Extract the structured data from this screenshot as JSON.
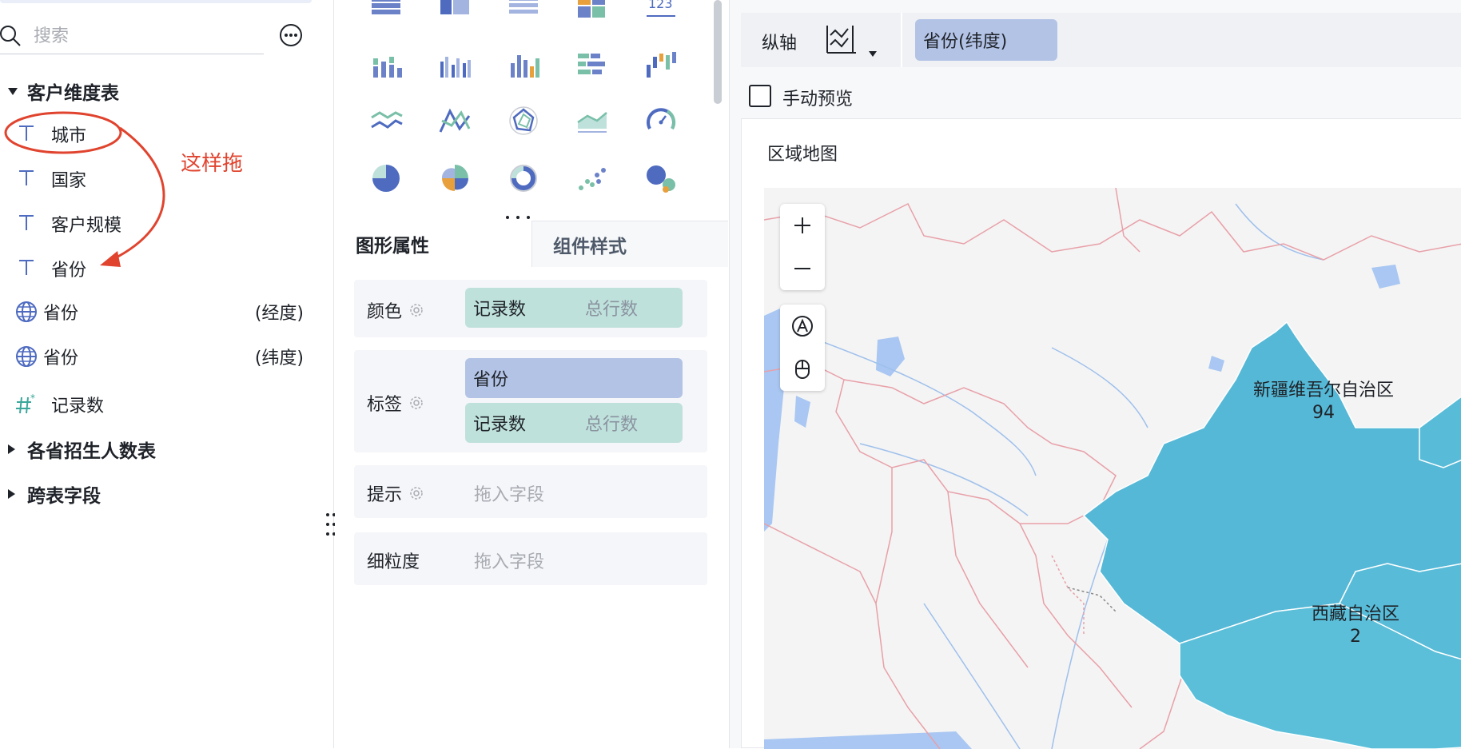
{
  "left": {
    "search_placeholder": "搜索",
    "groups": [
      {
        "label": "客户维度表",
        "expanded": true
      },
      {
        "label": "各省招生人数表",
        "expanded": false
      },
      {
        "label": "跨表字段",
        "expanded": false
      }
    ],
    "fields": [
      {
        "type": "text",
        "label": "城市"
      },
      {
        "type": "text",
        "label": "国家"
      },
      {
        "type": "text",
        "label": "客户规模"
      },
      {
        "type": "text",
        "label": "省份"
      },
      {
        "type": "geo",
        "label": "省份",
        "suffix": "(经度)"
      },
      {
        "type": "geo",
        "label": "省份",
        "suffix": "(纬度)"
      },
      {
        "type": "measure",
        "label": "记录数"
      }
    ],
    "annotation": "这样拖"
  },
  "middle": {
    "tabs": [
      "图形属性",
      "组件样式"
    ],
    "active_tab": "图形属性",
    "properties": {
      "color": {
        "label": "颜色",
        "pill_main": "记录数",
        "pill_sub": "总行数"
      },
      "tag": {
        "label": "标签",
        "pill1": "省份",
        "pill2_main": "记录数",
        "pill2_sub": "总行数"
      },
      "tooltip": {
        "label": "提示",
        "hint": "拖入字段"
      },
      "granularity": {
        "label": "细粒度",
        "hint": "拖入字段"
      }
    }
  },
  "right": {
    "yaxis_label": "纵轴",
    "yaxis_field": "省份(纬度)",
    "manual_preview": "手动预览",
    "map_title": "区域地图",
    "regions": [
      {
        "name": "新疆维吾尔自治区",
        "value": "94"
      },
      {
        "name": "西藏自治区",
        "value": "2"
      }
    ],
    "colors": {
      "region_fill": "#55b8d6",
      "border": "#e8a0a8",
      "water": "#a9c7f2"
    }
  }
}
